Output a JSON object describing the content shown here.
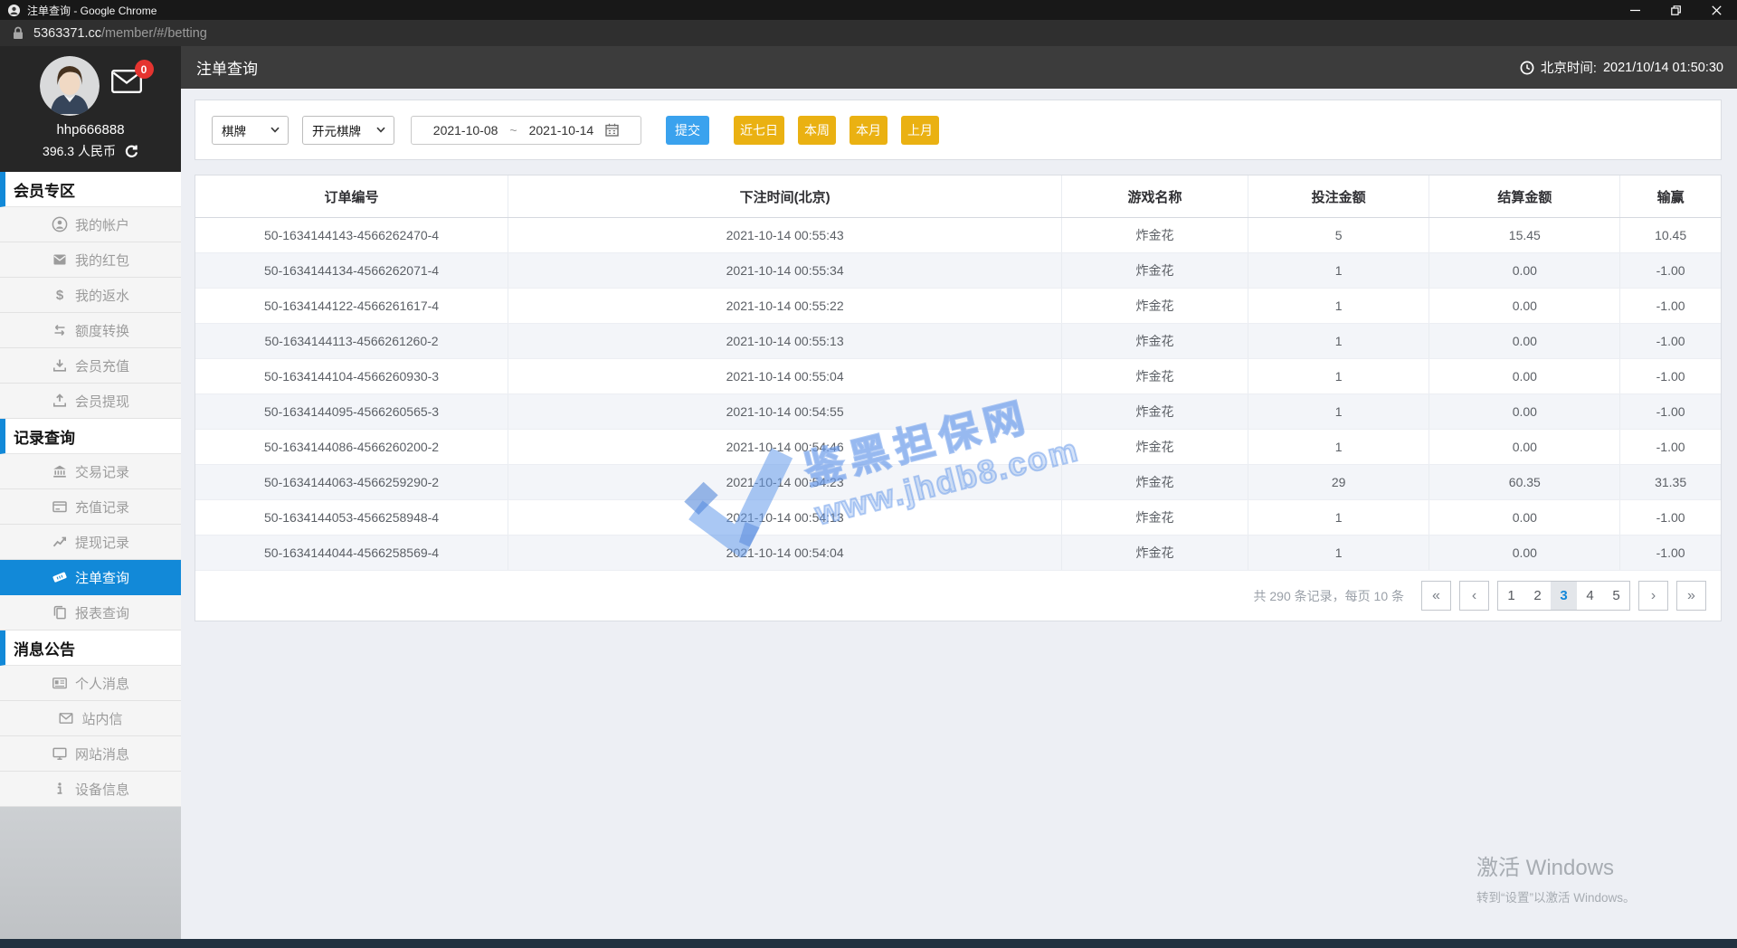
{
  "window": {
    "title": "注单查询 - Google Chrome",
    "url_host": "5363371.cc",
    "url_path": "/member/#/betting"
  },
  "user": {
    "username": "hhp666888",
    "balance": "396.3 人民币",
    "unread_count": "0"
  },
  "header": {
    "page_title": "注单查询",
    "beijing_time_label": "北京时间:",
    "beijing_time_value": "2021/10/14 01:50:30"
  },
  "sidebar": {
    "sections": [
      {
        "key": "member-zone",
        "title": "会员专区",
        "items": [
          {
            "key": "my-account",
            "label": "我的帐户",
            "icon": "user-icon"
          },
          {
            "key": "my-red-packet",
            "label": "我的红包",
            "icon": "red-packet-icon"
          },
          {
            "key": "my-rebate",
            "label": "我的返水",
            "icon": "dollar-icon"
          },
          {
            "key": "quota-transfer",
            "label": "额度转换",
            "icon": "transfer-icon"
          },
          {
            "key": "member-deposit",
            "label": "会员充值",
            "icon": "deposit-icon"
          },
          {
            "key": "member-withdraw",
            "label": "会员提现",
            "icon": "withdraw-icon"
          }
        ]
      },
      {
        "key": "records-query",
        "title": "记录查询",
        "items": [
          {
            "key": "transaction-records",
            "label": "交易记录",
            "icon": "bank-icon"
          },
          {
            "key": "deposit-records",
            "label": "充值记录",
            "icon": "card-icon"
          },
          {
            "key": "withdraw-records",
            "label": "提现记录",
            "icon": "chart-icon"
          },
          {
            "key": "bet-query",
            "label": "注单查询",
            "icon": "ticket-icon",
            "active": true
          },
          {
            "key": "report-query",
            "label": "报表查询",
            "icon": "report-icon"
          }
        ]
      },
      {
        "key": "announcements",
        "title": "消息公告",
        "items": [
          {
            "key": "personal-messages",
            "label": "个人消息",
            "icon": "id-card-icon"
          },
          {
            "key": "site-mail",
            "label": "站内信",
            "icon": "mail-icon"
          },
          {
            "key": "site-messages",
            "label": "网站消息",
            "icon": "monitor-icon"
          },
          {
            "key": "device-info",
            "label": "设备信息",
            "icon": "info-icon"
          }
        ]
      }
    ]
  },
  "filters": {
    "category_select": "棋牌",
    "provider_select": "开元棋牌",
    "date_from": "2021-10-08",
    "date_separator": "~",
    "date_to": "2021-10-14",
    "submit_label": "提交",
    "quick_ranges": [
      {
        "key": "last-7-days",
        "label": "近七日"
      },
      {
        "key": "this-week",
        "label": "本周"
      },
      {
        "key": "this-month",
        "label": "本月"
      },
      {
        "key": "last-month",
        "label": "上月"
      }
    ]
  },
  "table": {
    "columns": [
      {
        "key": "order-id",
        "label": "订单编号"
      },
      {
        "key": "bet-time",
        "label": "下注时间(北京)"
      },
      {
        "key": "game-name",
        "label": "游戏名称"
      },
      {
        "key": "bet-amount",
        "label": "投注金额"
      },
      {
        "key": "settle-amount",
        "label": "结算金额"
      },
      {
        "key": "win-loss",
        "label": "输赢"
      }
    ],
    "rows": [
      [
        "50-1634144143-4566262470-4",
        "2021-10-14 00:55:43",
        "炸金花",
        "5",
        "15.45",
        "10.45"
      ],
      [
        "50-1634144134-4566262071-4",
        "2021-10-14 00:55:34",
        "炸金花",
        "1",
        "0.00",
        "-1.00"
      ],
      [
        "50-1634144122-4566261617-4",
        "2021-10-14 00:55:22",
        "炸金花",
        "1",
        "0.00",
        "-1.00"
      ],
      [
        "50-1634144113-4566261260-2",
        "2021-10-14 00:55:13",
        "炸金花",
        "1",
        "0.00",
        "-1.00"
      ],
      [
        "50-1634144104-4566260930-3",
        "2021-10-14 00:55:04",
        "炸金花",
        "1",
        "0.00",
        "-1.00"
      ],
      [
        "50-1634144095-4566260565-3",
        "2021-10-14 00:54:55",
        "炸金花",
        "1",
        "0.00",
        "-1.00"
      ],
      [
        "50-1634144086-4566260200-2",
        "2021-10-14 00:54:46",
        "炸金花",
        "1",
        "0.00",
        "-1.00"
      ],
      [
        "50-1634144063-4566259290-2",
        "2021-10-14 00:54:23",
        "炸金花",
        "29",
        "60.35",
        "31.35"
      ],
      [
        "50-1634144053-4566258948-4",
        "2021-10-14 00:54:13",
        "炸金花",
        "1",
        "0.00",
        "-1.00"
      ],
      [
        "50-1634144044-4566258569-4",
        "2021-10-14 00:54:04",
        "炸金花",
        "1",
        "0.00",
        "-1.00"
      ]
    ]
  },
  "pagination": {
    "summary": "共 290 条记录，每页 10 条",
    "first": "«",
    "prev": "‹",
    "pages": [
      "1",
      "2",
      "3",
      "4",
      "5"
    ],
    "active_page": "3",
    "next": "›",
    "last": "»"
  },
  "watermark": {
    "brand": "鉴黑担保网",
    "url": "www.jhdb8.com"
  },
  "activate": {
    "line1": "激活 Windows",
    "line2": "转到“设置”以激活 Windows。"
  },
  "colors": {
    "accent_blue": "#1289d8",
    "submit_blue": "#3aa2ee",
    "quick_yellow": "#eab112",
    "badge_red": "#e53430"
  }
}
